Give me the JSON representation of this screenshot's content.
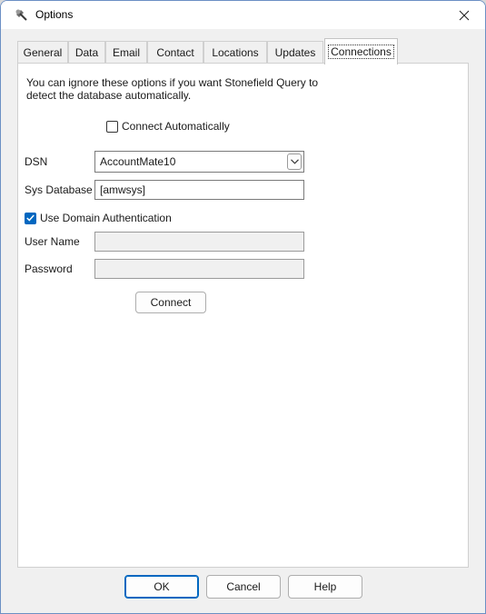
{
  "window": {
    "title": "Options"
  },
  "tabs": [
    {
      "label": "General"
    },
    {
      "label": "Data"
    },
    {
      "label": "Email"
    },
    {
      "label": "Contact"
    },
    {
      "label": "Locations"
    },
    {
      "label": "Updates"
    },
    {
      "label": "Connections"
    }
  ],
  "connections": {
    "intro_line1": "You can ignore these options if you want Stonefield Query to",
    "intro_line2": "detect the database automatically.",
    "connect_auto_label": "Connect Automatically",
    "connect_auto_checked": false,
    "dsn_label": "DSN",
    "dsn_value": "AccountMate10",
    "sysdb_label": "Sys Database",
    "sysdb_value": "[amwsys]",
    "domain_auth_label": "Use Domain Authentication",
    "domain_auth_checked": true,
    "username_label": "User Name",
    "username_value": "",
    "password_label": "Password",
    "password_value": "",
    "connect_button": "Connect"
  },
  "footer": {
    "ok": "OK",
    "cancel": "Cancel",
    "help": "Help"
  },
  "colors": {
    "accent": "#0067c0"
  }
}
